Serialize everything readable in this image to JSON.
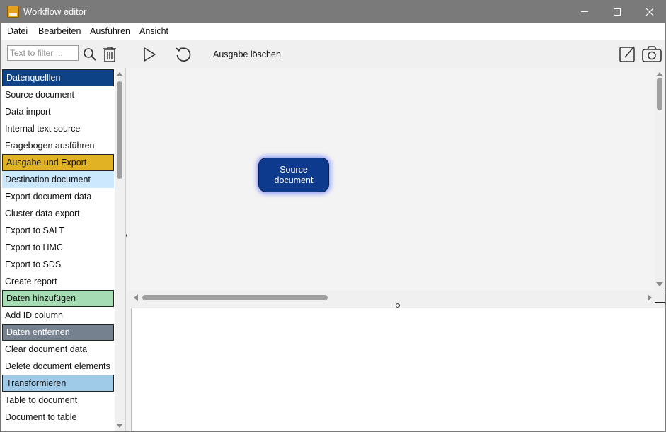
{
  "window": {
    "title": "Workflow editor"
  },
  "menu": [
    "Datei",
    "Bearbeiten",
    "Ausführen",
    "Ansicht"
  ],
  "filter": {
    "placeholder": "Text to filter ..."
  },
  "toolbar": {
    "clear_output_label": "Ausgabe löschen"
  },
  "list": {
    "items": [
      {
        "label": "Datenquelllen",
        "type": "header",
        "bg": "#0e4287",
        "fg": "#ffffff"
      },
      {
        "label": "Source document",
        "type": "item"
      },
      {
        "label": "Data import",
        "type": "item"
      },
      {
        "label": "Internal text source",
        "type": "item"
      },
      {
        "label": "Fragebogen ausführen",
        "type": "item"
      },
      {
        "label": "Ausgabe und Export",
        "type": "header",
        "bg": "#e1b324",
        "fg": "#111111"
      },
      {
        "label": "Destination document",
        "type": "item",
        "selected": true
      },
      {
        "label": "Export document data",
        "type": "item"
      },
      {
        "label": "Cluster data export",
        "type": "item"
      },
      {
        "label": "Export to SALT",
        "type": "item"
      },
      {
        "label": "Export to HMC",
        "type": "item"
      },
      {
        "label": "Export to SDS",
        "type": "item"
      },
      {
        "label": "Create report",
        "type": "item"
      },
      {
        "label": "Daten hinzufügen",
        "type": "header",
        "bg": "#a5dcb4",
        "fg": "#111111"
      },
      {
        "label": "Add ID column",
        "type": "item"
      },
      {
        "label": "Daten entfernen",
        "type": "header",
        "bg": "#76818f",
        "fg": "#ffffff"
      },
      {
        "label": "Clear document data",
        "type": "item"
      },
      {
        "label": "Delete document elements",
        "type": "item"
      },
      {
        "label": "Transformieren",
        "type": "header",
        "bg": "#9fcbe8",
        "fg": "#111111"
      },
      {
        "label": "Table to document",
        "type": "item"
      },
      {
        "label": "Document to table",
        "type": "item"
      }
    ]
  },
  "canvas": {
    "node": {
      "label_line1": "Source",
      "label_line2": "document"
    }
  },
  "colors": {
    "titlebar": "#7a7a7a",
    "node_fill": "#0d3a8c",
    "selected_item": "#cce8ff"
  },
  "icons": [
    "app-icon",
    "search-icon",
    "trash-icon",
    "play-icon",
    "refresh-icon",
    "edit-icon",
    "camera-icon"
  ]
}
